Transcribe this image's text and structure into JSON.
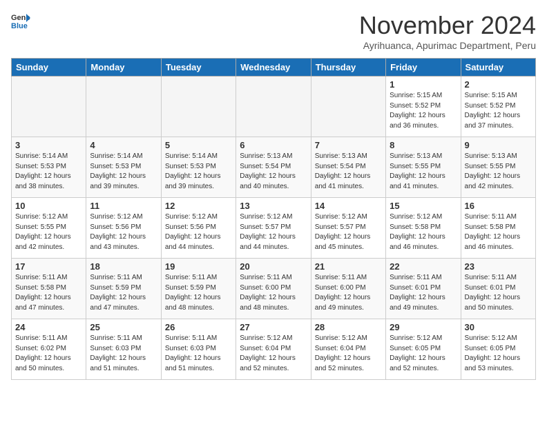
{
  "header": {
    "logo_line1": "General",
    "logo_line2": "Blue",
    "month": "November 2024",
    "location": "Ayrihuanca, Apurimac Department, Peru"
  },
  "weekdays": [
    "Sunday",
    "Monday",
    "Tuesday",
    "Wednesday",
    "Thursday",
    "Friday",
    "Saturday"
  ],
  "weeks": [
    [
      {
        "day": "",
        "info": ""
      },
      {
        "day": "",
        "info": ""
      },
      {
        "day": "",
        "info": ""
      },
      {
        "day": "",
        "info": ""
      },
      {
        "day": "",
        "info": ""
      },
      {
        "day": "1",
        "info": "Sunrise: 5:15 AM\nSunset: 5:52 PM\nDaylight: 12 hours\nand 36 minutes."
      },
      {
        "day": "2",
        "info": "Sunrise: 5:15 AM\nSunset: 5:52 PM\nDaylight: 12 hours\nand 37 minutes."
      }
    ],
    [
      {
        "day": "3",
        "info": "Sunrise: 5:14 AM\nSunset: 5:53 PM\nDaylight: 12 hours\nand 38 minutes."
      },
      {
        "day": "4",
        "info": "Sunrise: 5:14 AM\nSunset: 5:53 PM\nDaylight: 12 hours\nand 39 minutes."
      },
      {
        "day": "5",
        "info": "Sunrise: 5:14 AM\nSunset: 5:53 PM\nDaylight: 12 hours\nand 39 minutes."
      },
      {
        "day": "6",
        "info": "Sunrise: 5:13 AM\nSunset: 5:54 PM\nDaylight: 12 hours\nand 40 minutes."
      },
      {
        "day": "7",
        "info": "Sunrise: 5:13 AM\nSunset: 5:54 PM\nDaylight: 12 hours\nand 41 minutes."
      },
      {
        "day": "8",
        "info": "Sunrise: 5:13 AM\nSunset: 5:55 PM\nDaylight: 12 hours\nand 41 minutes."
      },
      {
        "day": "9",
        "info": "Sunrise: 5:13 AM\nSunset: 5:55 PM\nDaylight: 12 hours\nand 42 minutes."
      }
    ],
    [
      {
        "day": "10",
        "info": "Sunrise: 5:12 AM\nSunset: 5:55 PM\nDaylight: 12 hours\nand 42 minutes."
      },
      {
        "day": "11",
        "info": "Sunrise: 5:12 AM\nSunset: 5:56 PM\nDaylight: 12 hours\nand 43 minutes."
      },
      {
        "day": "12",
        "info": "Sunrise: 5:12 AM\nSunset: 5:56 PM\nDaylight: 12 hours\nand 44 minutes."
      },
      {
        "day": "13",
        "info": "Sunrise: 5:12 AM\nSunset: 5:57 PM\nDaylight: 12 hours\nand 44 minutes."
      },
      {
        "day": "14",
        "info": "Sunrise: 5:12 AM\nSunset: 5:57 PM\nDaylight: 12 hours\nand 45 minutes."
      },
      {
        "day": "15",
        "info": "Sunrise: 5:12 AM\nSunset: 5:58 PM\nDaylight: 12 hours\nand 46 minutes."
      },
      {
        "day": "16",
        "info": "Sunrise: 5:11 AM\nSunset: 5:58 PM\nDaylight: 12 hours\nand 46 minutes."
      }
    ],
    [
      {
        "day": "17",
        "info": "Sunrise: 5:11 AM\nSunset: 5:58 PM\nDaylight: 12 hours\nand 47 minutes."
      },
      {
        "day": "18",
        "info": "Sunrise: 5:11 AM\nSunset: 5:59 PM\nDaylight: 12 hours\nand 47 minutes."
      },
      {
        "day": "19",
        "info": "Sunrise: 5:11 AM\nSunset: 5:59 PM\nDaylight: 12 hours\nand 48 minutes."
      },
      {
        "day": "20",
        "info": "Sunrise: 5:11 AM\nSunset: 6:00 PM\nDaylight: 12 hours\nand 48 minutes."
      },
      {
        "day": "21",
        "info": "Sunrise: 5:11 AM\nSunset: 6:00 PM\nDaylight: 12 hours\nand 49 minutes."
      },
      {
        "day": "22",
        "info": "Sunrise: 5:11 AM\nSunset: 6:01 PM\nDaylight: 12 hours\nand 49 minutes."
      },
      {
        "day": "23",
        "info": "Sunrise: 5:11 AM\nSunset: 6:01 PM\nDaylight: 12 hours\nand 50 minutes."
      }
    ],
    [
      {
        "day": "24",
        "info": "Sunrise: 5:11 AM\nSunset: 6:02 PM\nDaylight: 12 hours\nand 50 minutes."
      },
      {
        "day": "25",
        "info": "Sunrise: 5:11 AM\nSunset: 6:03 PM\nDaylight: 12 hours\nand 51 minutes."
      },
      {
        "day": "26",
        "info": "Sunrise: 5:11 AM\nSunset: 6:03 PM\nDaylight: 12 hours\nand 51 minutes."
      },
      {
        "day": "27",
        "info": "Sunrise: 5:12 AM\nSunset: 6:04 PM\nDaylight: 12 hours\nand 52 minutes."
      },
      {
        "day": "28",
        "info": "Sunrise: 5:12 AM\nSunset: 6:04 PM\nDaylight: 12 hours\nand 52 minutes."
      },
      {
        "day": "29",
        "info": "Sunrise: 5:12 AM\nSunset: 6:05 PM\nDaylight: 12 hours\nand 52 minutes."
      },
      {
        "day": "30",
        "info": "Sunrise: 5:12 AM\nSunset: 6:05 PM\nDaylight: 12 hours\nand 53 minutes."
      }
    ]
  ]
}
